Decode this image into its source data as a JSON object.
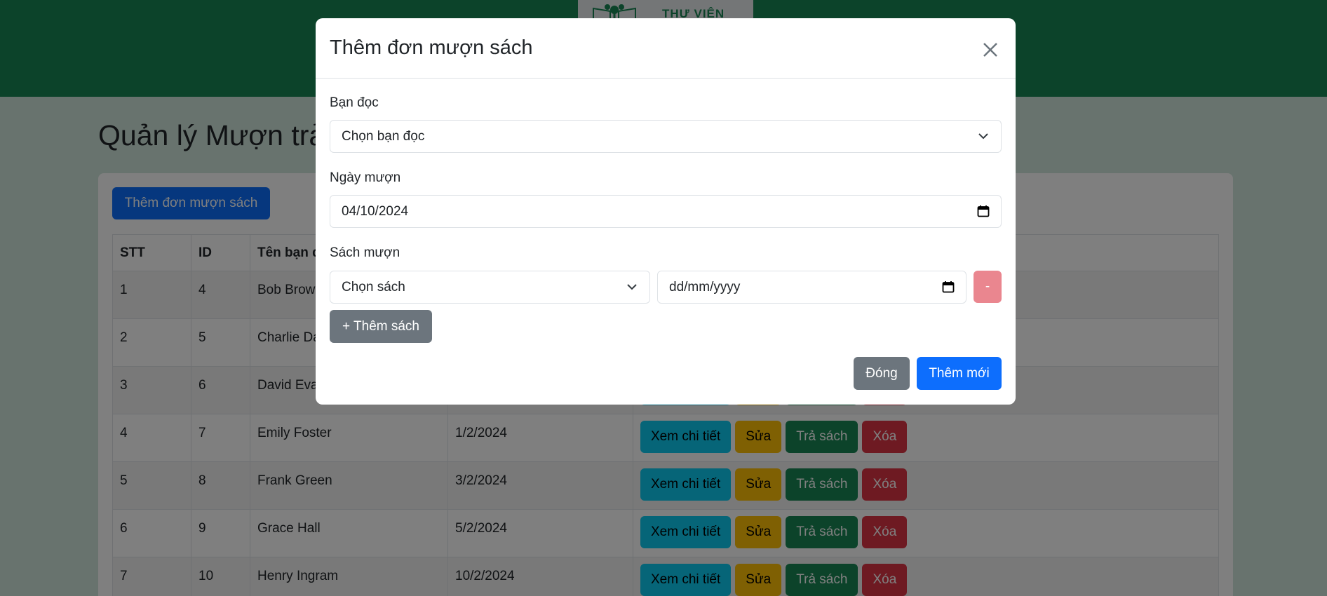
{
  "header": {
    "logo_text": "THƯ VIỆN"
  },
  "page": {
    "title": "Quản lý Mượn trả",
    "add_button": "Thêm đơn mượn sách"
  },
  "table": {
    "headers": [
      "STT",
      "ID",
      "Tên bạn đọc"
    ],
    "rows": [
      {
        "stt": "1",
        "id": "4",
        "name": "Bob Brown",
        "date": ""
      },
      {
        "stt": "2",
        "id": "5",
        "name": "Charlie Davis",
        "date": ""
      },
      {
        "stt": "3",
        "id": "6",
        "name": "David Evans",
        "date": ""
      },
      {
        "stt": "4",
        "id": "7",
        "name": "Emily Foster",
        "date": "1/2/2024"
      },
      {
        "stt": "5",
        "id": "8",
        "name": "Frank Green",
        "date": "3/2/2024"
      },
      {
        "stt": "6",
        "id": "9",
        "name": "Grace Hall",
        "date": "5/2/2024"
      },
      {
        "stt": "7",
        "id": "10",
        "name": "Henry Ingram",
        "date": "10/2/2024"
      }
    ],
    "actions": {
      "view": "Xem chi tiết",
      "edit": "Sửa",
      "return": "Trả sách",
      "delete": "Xóa"
    }
  },
  "modal": {
    "title": "Thêm đơn mượn sách",
    "reader_label": "Bạn đọc",
    "reader_placeholder": "Chọn bạn đọc",
    "date_label": "Ngày mượn",
    "date_value": "04/10/2024",
    "books_label": "Sách mượn",
    "book_placeholder": "Chọn sách",
    "due_date_placeholder": "dd/mm/yyyy",
    "remove_label": "-",
    "add_book_label": "+ Thêm sách",
    "close_label": "Đóng",
    "submit_label": "Thêm mới"
  },
  "colors": {
    "primary": "#0d6efd",
    "success": "#198754",
    "secondary": "#6c757d",
    "danger": "#dc3545",
    "warning": "#ffc107",
    "info": "#0dcaf0"
  }
}
